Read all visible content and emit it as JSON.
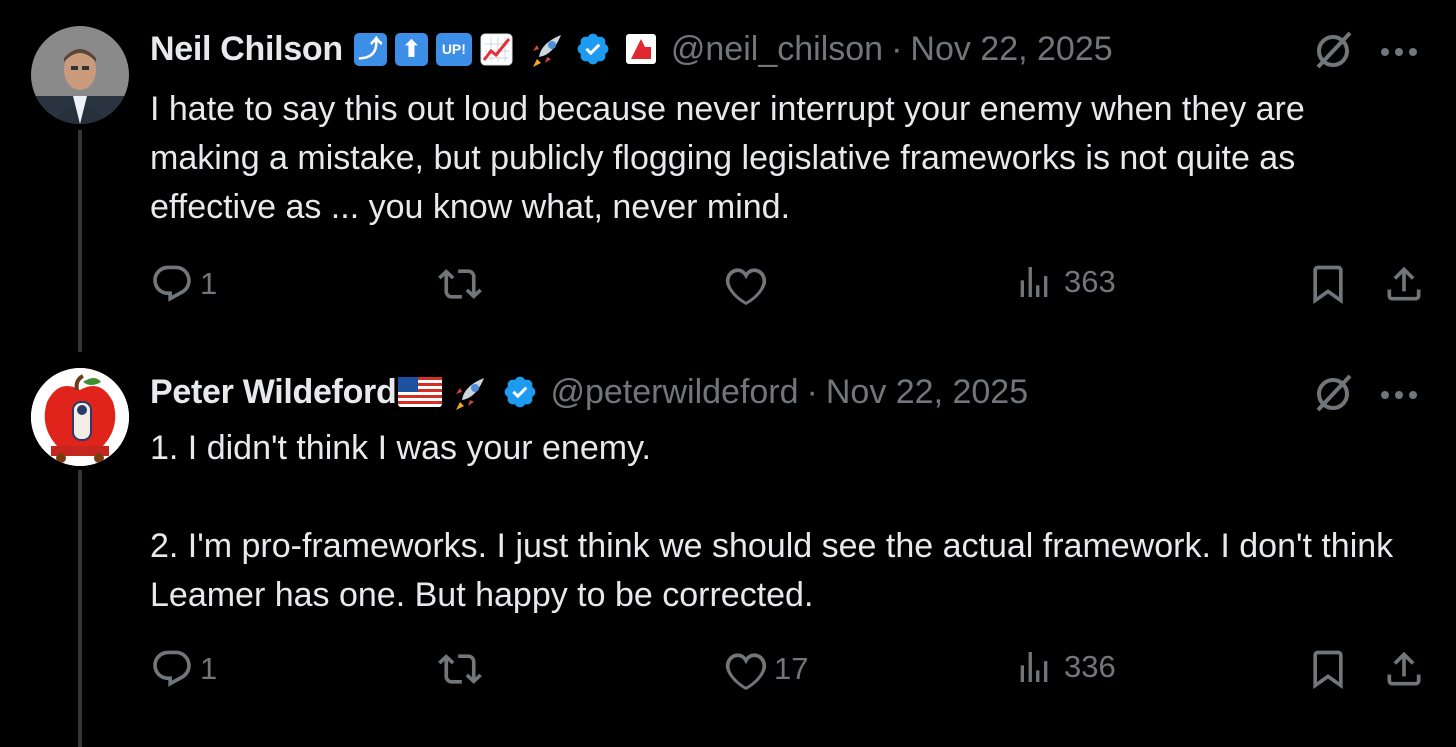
{
  "tweets": [
    {
      "name": "Neil Chilson",
      "handle": "@neil_chilson",
      "separator": "·",
      "date": "Nov 22, 2025",
      "badge_up_label": "UP!",
      "text": "I hate to say this out loud because never interrupt your enemy when they are making a mistake, but publicly flogging legislative frameworks is not quite as effective as ... you know what, never mind.",
      "replies": "1",
      "reposts": "",
      "likes": "",
      "views": "363",
      "badges": [
        "arrow-turn-up-emoji",
        "arrow-up-emoji",
        "up-button-emoji",
        "chart-increasing-emoji",
        "rocket-emoji",
        "verified-badge",
        "red-flag-logo"
      ]
    },
    {
      "name": "Peter Wildeford",
      "handle": "@peterwildeford",
      "separator": "·",
      "date": "Nov 22, 2025",
      "text_lines": [
        "1. I didn't think I was your enemy.",
        "",
        "2. I'm pro-frameworks. I just think we should see the actual framework. I don't think Leamer has one. But happy to be corrected."
      ],
      "replies": "1",
      "reposts": "",
      "likes": "17",
      "views": "336",
      "badges": [
        "us-flag-emoji",
        "rocket-emoji",
        "verified-badge"
      ]
    }
  ],
  "colors": {
    "background": "#000000",
    "text": "#e7e9ea",
    "muted": "#71767b",
    "verified": "#1d9bf0",
    "thread_line": "#333639"
  }
}
